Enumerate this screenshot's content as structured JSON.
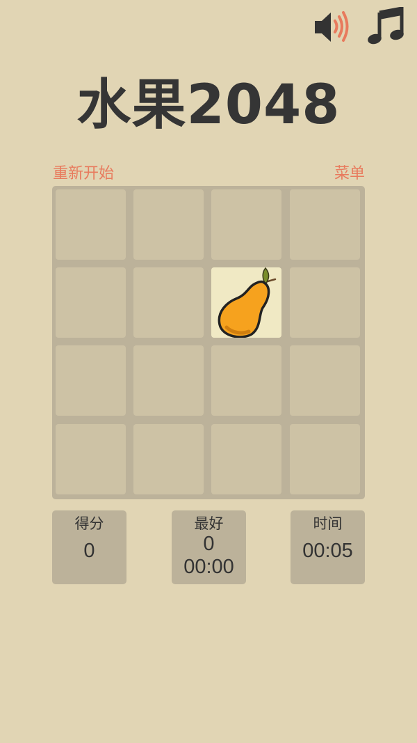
{
  "title": "水果2048",
  "controls": {
    "restart_label": "重新开始",
    "menu_label": "菜单",
    "sound_icon": "speaker-on-icon",
    "music_icon": "music-note-icon"
  },
  "board": {
    "size": 4,
    "tiles": [
      {
        "row": 1,
        "col": 2,
        "fruit": "pear-icon"
      }
    ]
  },
  "stats": {
    "score_label": "得分",
    "score_value": "0",
    "best_label": "最好",
    "best_score": "0",
    "best_time": "00:00",
    "time_label": "时间",
    "time_value": "00:05"
  },
  "colors": {
    "background": "#e1d5b4",
    "board": "#bcb29a",
    "cell": "#cdc2a5",
    "tile": "#f0e9c4",
    "link": "#e87a5d",
    "title": "#353535"
  }
}
